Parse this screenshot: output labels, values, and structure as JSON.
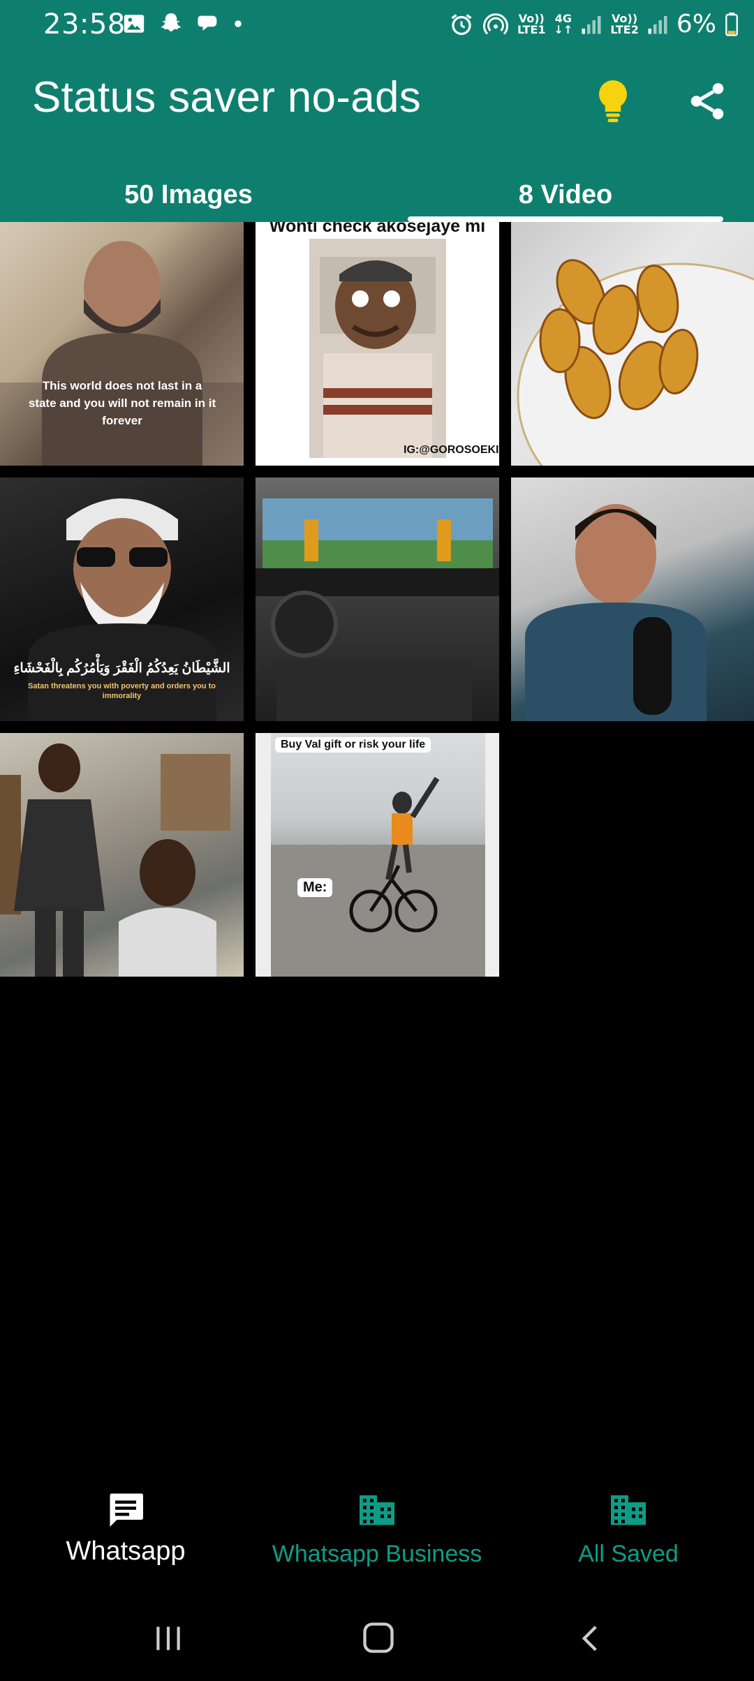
{
  "status_bar": {
    "time": "23:58",
    "sim1": {
      "top": "Vo))",
      "bottom": "LTE1"
    },
    "net": {
      "top": "4G",
      "bottom": "↓↑"
    },
    "sim2": {
      "top": "Vo))",
      "bottom": "LTE2"
    },
    "battery": "6%"
  },
  "app_bar": {
    "title": "Status saver no-ads",
    "accent_color": "#0e7f6e",
    "bulb_color": "#f5d30f"
  },
  "tabs": [
    {
      "label": "50 Images",
      "selected": false
    },
    {
      "label": "8 Video",
      "selected": true
    }
  ],
  "thumbnails": [
    {
      "name": "bearded man portrait",
      "caption": "This world does not last in a state and you will not remain in it forever"
    },
    {
      "name": "cartoon face meme",
      "caption": "Wonti check akosejaye mi",
      "watermark": "IG:@GOROSOEKITI"
    },
    {
      "name": "fried plantain plate"
    },
    {
      "name": "elder scholar portrait",
      "caption_arabic": "الشَّيْطَانُ يَعِدُكُمُ الْفَقْرَ وَيَأْمُرُكُم بِالْفَحْشَاءِ",
      "caption": "Satan threatens you with poverty and orders you to immorality"
    },
    {
      "name": "racing simulator"
    },
    {
      "name": "young man with microphone"
    },
    {
      "name": "two young men outdoors"
    },
    {
      "name": "bicycle meme",
      "caption": "Buy Val gift or risk your life",
      "label": "Me:"
    }
  ],
  "bottom_nav": [
    {
      "label": "Whatsapp",
      "icon": "chat-icon",
      "selected": true
    },
    {
      "label": "Whatsapp Business",
      "icon": "business-icon",
      "selected": false
    },
    {
      "label": "All Saved",
      "icon": "business-icon",
      "selected": false
    }
  ],
  "system_nav": {
    "icons": [
      "recents-icon",
      "home-icon",
      "back-icon"
    ]
  }
}
